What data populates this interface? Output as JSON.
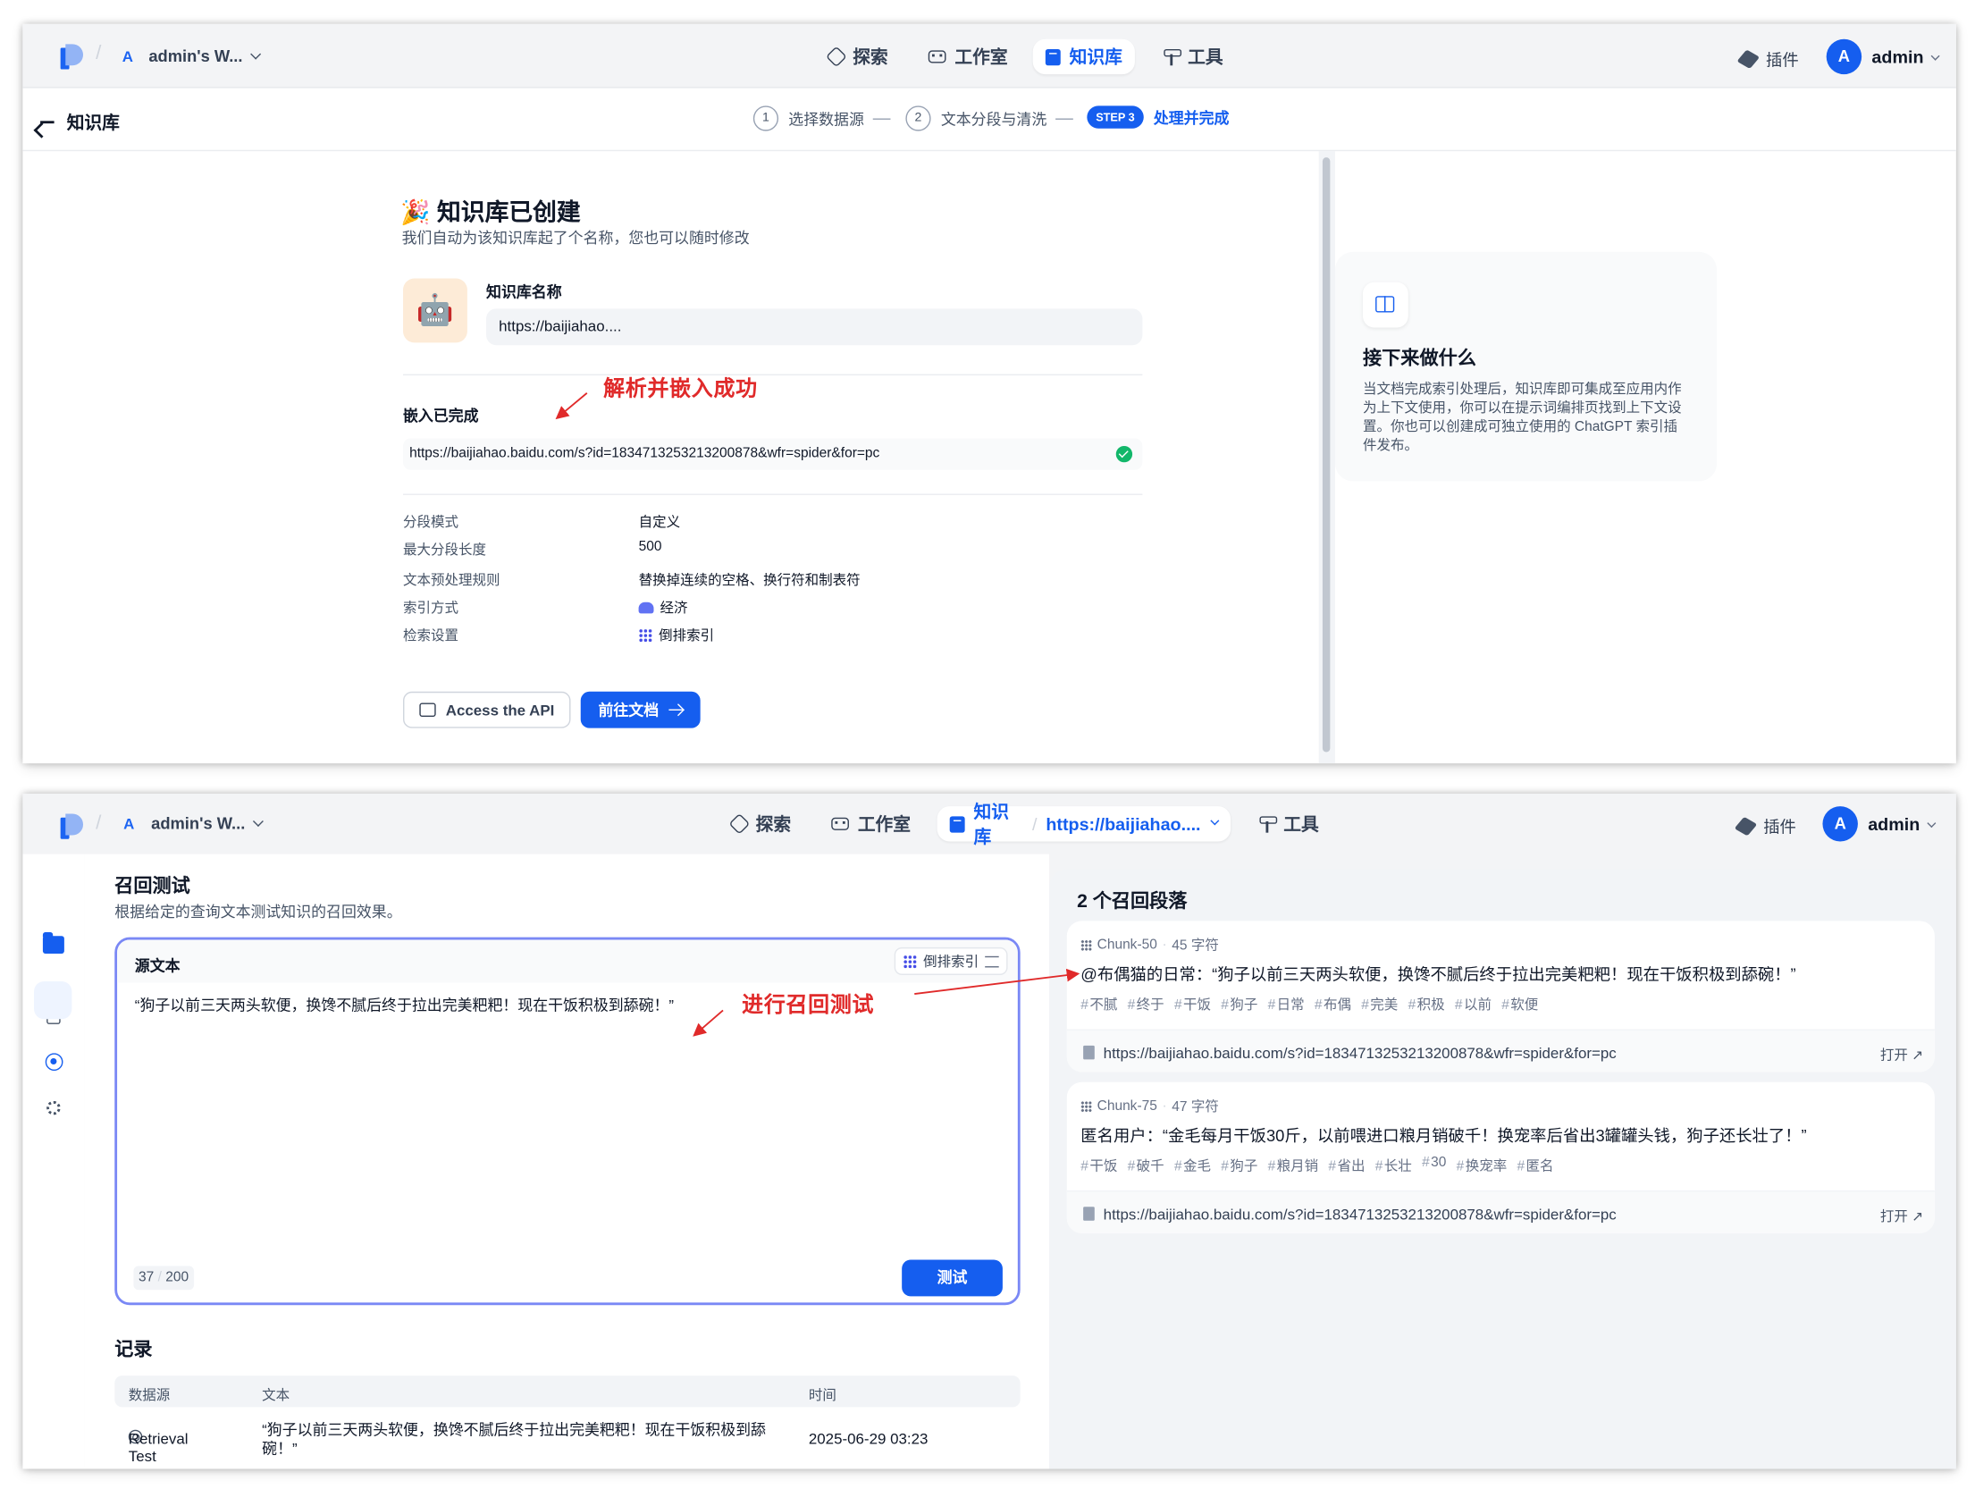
{
  "top_screen": {
    "header": {
      "workspace_initial": "A",
      "workspace_name": "admin's W...",
      "nav": [
        "探索",
        "工作室",
        "知识库",
        "工具"
      ],
      "plugin_label": "插件",
      "avatar_initial": "A",
      "user_name": "admin"
    },
    "stepbar": {
      "back_label": "知识库",
      "steps": [
        {
          "num": "1",
          "label": "选择数据源"
        },
        {
          "num": "2",
          "label": "文本分段与清洗"
        },
        {
          "num": "STEP 3",
          "label": "处理并完成"
        }
      ]
    },
    "created": {
      "emoji": "🎉",
      "title": "知识库已创建",
      "subtitle": "我们自动为该知识库起了个名称，您也可以随时修改",
      "robot_emoji": "🤖",
      "name_label": "知识库名称",
      "name_value": "https://baijiahao....",
      "annotation": "解析并嵌入成功",
      "embed_label": "嵌入已完成",
      "embed_url": "https://baijiahao.baidu.com/s?id=1834713253213200878&wfr=spider&for=pc",
      "settings": [
        {
          "key": "分段模式",
          "value": "自定义"
        },
        {
          "key": "最大分段长度",
          "value": "500"
        },
        {
          "key": "文本预处理规则",
          "value": "替换掉连续的空格、换行符和制表符"
        },
        {
          "key": "索引方式",
          "value": "经济",
          "icon": "piggy-bank-icon"
        },
        {
          "key": "检索设置",
          "value": "倒排索引",
          "icon": "grid-icon"
        }
      ],
      "api_button": "Access the API",
      "goto_button": "前往文档"
    },
    "next_card": {
      "title": "接下来做什么",
      "body": "当文档完成索引处理后，知识库即可集成至应用内作为上下文使用，你可以在提示词编排页找到上下文设置。你也可以创建成可独立使用的 ChatGPT 索引插件发布。"
    }
  },
  "bottom_screen": {
    "header": {
      "workspace_initial": "A",
      "workspace_name": "admin's W...",
      "nav": [
        "探索",
        "工作室",
        "知识库",
        "工具"
      ],
      "dataset_crumb": "https://baijiahao....",
      "plugin_label": "插件",
      "avatar_initial": "A",
      "user_name": "admin"
    },
    "retrieval": {
      "title": "召回测试",
      "subtitle": "根据给定的查询文本测试知识的召回效果。",
      "source_label": "源文本",
      "mode_label": "倒排索引",
      "query_text": "“狗子以前三天两头软便，换馋不腻后终于拉出完美粑粑！现在干饭积极到舔碗！”",
      "annotation": "进行召回测试",
      "count": "37",
      "limit": "200",
      "test_button": "测试"
    },
    "records": {
      "title": "记录",
      "columns": [
        "数据源",
        "文本",
        "时间"
      ],
      "rows": [
        {
          "source": "Retrieval Test",
          "text_line1": "“狗子以前三天两头软便，换馋不腻后终于拉出完美粑粑！现在干饭积极到舔",
          "text_line2": "碗！”",
          "time": "2025-06-29 03:23"
        }
      ]
    },
    "results": {
      "title": "2 个召回段落",
      "chunks": [
        {
          "id": "Chunk-50",
          "chars": "45 字符",
          "text": "@布偶猫的日常：“狗子以前三天两头软便，换馋不腻后终于拉出完美粑粑！现在干饭积极到舔碗！”",
          "tags": [
            "不腻",
            "终于",
            "干饭",
            "狗子",
            "日常",
            "布偶",
            "完美",
            "积极",
            "以前",
            "软便"
          ],
          "url": "https://baijiahao.baidu.com/s?id=1834713253213200878&wfr=spider&for=pc",
          "open_label": "打开 ↗"
        },
        {
          "id": "Chunk-75",
          "chars": "47 字符",
          "text": "匿名用户：“金毛每月干饭30斤，以前喂进口粮月销破千！换宠率后省出3罐罐头钱，狗子还长壮了！”",
          "tags": [
            "干饭",
            "破千",
            "金毛",
            "狗子",
            "粮月销",
            "省出",
            "长壮",
            "30",
            "换宠率",
            "匿名"
          ],
          "url": "https://baijiahao.baidu.com/s?id=1834713253213200878&wfr=spider&for=pc",
          "open_label": "打开 ↗"
        }
      ]
    }
  },
  "colors": {
    "accent": "#155eef",
    "annotation": "#e02a2a",
    "success": "#12b76a"
  }
}
